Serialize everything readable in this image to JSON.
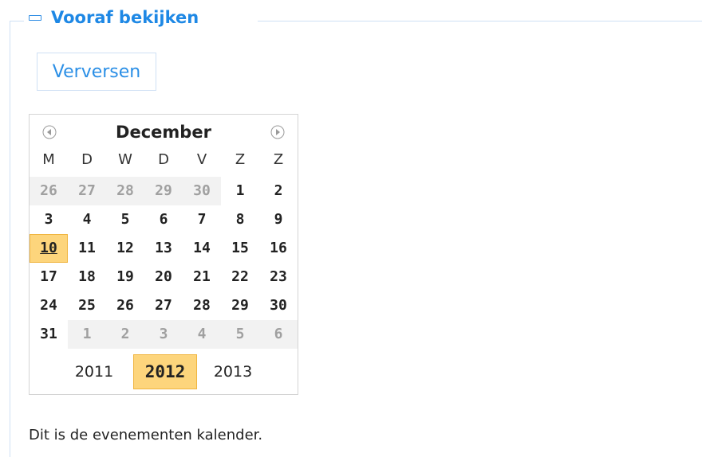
{
  "panel": {
    "title": "Vooraf bekijken",
    "collapse_icon": "minus-box-icon"
  },
  "toolbar": {
    "refresh_label": "Verversen"
  },
  "calendar": {
    "month": "December",
    "prev_icon": "circle-arrow-left-icon",
    "next_icon": "circle-arrow-right-icon",
    "weekdays": [
      "M",
      "D",
      "W",
      "D",
      "V",
      "Z",
      "Z"
    ],
    "days": [
      {
        "label": "26",
        "other": true
      },
      {
        "label": "27",
        "other": true
      },
      {
        "label": "28",
        "other": true
      },
      {
        "label": "29",
        "other": true
      },
      {
        "label": "30",
        "other": true
      },
      {
        "label": "1"
      },
      {
        "label": "2"
      },
      {
        "label": "3"
      },
      {
        "label": "4"
      },
      {
        "label": "5"
      },
      {
        "label": "6"
      },
      {
        "label": "7"
      },
      {
        "label": "8"
      },
      {
        "label": "9"
      },
      {
        "label": "10",
        "today": true
      },
      {
        "label": "11"
      },
      {
        "label": "12"
      },
      {
        "label": "13"
      },
      {
        "label": "14"
      },
      {
        "label": "15"
      },
      {
        "label": "16"
      },
      {
        "label": "17"
      },
      {
        "label": "18"
      },
      {
        "label": "19"
      },
      {
        "label": "20"
      },
      {
        "label": "21"
      },
      {
        "label": "22"
      },
      {
        "label": "23"
      },
      {
        "label": "24"
      },
      {
        "label": "25"
      },
      {
        "label": "26"
      },
      {
        "label": "27"
      },
      {
        "label": "28"
      },
      {
        "label": "29"
      },
      {
        "label": "30"
      },
      {
        "label": "31"
      },
      {
        "label": "1",
        "other": true
      },
      {
        "label": "2",
        "other": true
      },
      {
        "label": "3",
        "other": true
      },
      {
        "label": "4",
        "other": true
      },
      {
        "label": "5",
        "other": true
      },
      {
        "label": "6",
        "other": true
      }
    ],
    "years": [
      "2011",
      "2012",
      "2013"
    ],
    "selected_year": "2012"
  },
  "footer": {
    "text": "Dit is de evenementen kalender."
  },
  "colors": {
    "accent": "#1e88e5",
    "highlight": "#fdd57c",
    "frame": "#cfe0f4"
  }
}
